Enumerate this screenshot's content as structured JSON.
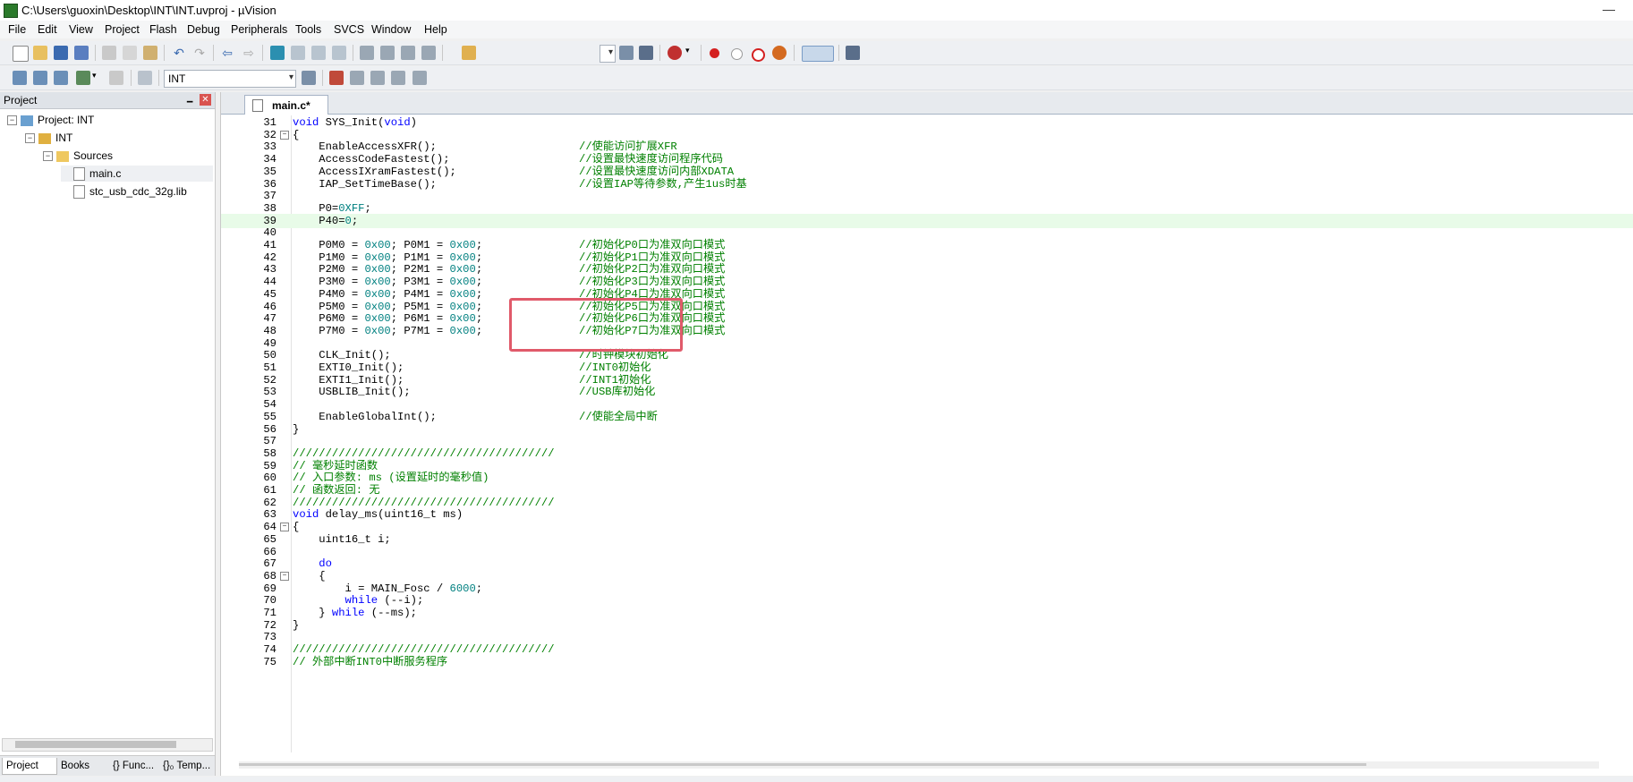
{
  "window": {
    "title": "C:\\Users\\guoxin\\Desktop\\INT\\INT.uvproj - µVision"
  },
  "menu": [
    "File",
    "Edit",
    "View",
    "Project",
    "Flash",
    "Debug",
    "Peripherals",
    "Tools",
    "SVCS",
    "Window",
    "Help"
  ],
  "toolbar2": {
    "target_value": "INT"
  },
  "project_panel": {
    "title": "Project",
    "tree": [
      {
        "label": "Project: INT",
        "level": 0,
        "icon": "project-icon"
      },
      {
        "label": "INT",
        "level": 1,
        "icon": "target-icon"
      },
      {
        "label": "Sources",
        "level": 2,
        "icon": "folder-icon"
      },
      {
        "label": "main.c",
        "level": 3,
        "icon": "file-icon"
      },
      {
        "label": "stc_usb_cdc_32g.lib",
        "level": 3,
        "icon": "file-icon"
      }
    ],
    "bottom_tabs": [
      "Project",
      "Books",
      "{} Func...",
      "{}₀ Temp..."
    ]
  },
  "editor": {
    "tab_label": "main.c*",
    "lines": [
      {
        "n": "31",
        "code": "void SYS_Init(void)",
        "comment": ""
      },
      {
        "n": "32",
        "code": "{",
        "comment": ""
      },
      {
        "n": "33",
        "code": "    EnableAccessXFR();",
        "comment": "//使能访问扩展XFR"
      },
      {
        "n": "34",
        "code": "    AccessCodeFastest();",
        "comment": "//设置最快速度访问程序代码"
      },
      {
        "n": "35",
        "code": "    AccessIXramFastest();",
        "comment": "//设置最快速度访问内部XDATA"
      },
      {
        "n": "36",
        "code": "    IAP_SetTimeBase();",
        "comment": "//设置IAP等待参数,产生1us时基"
      },
      {
        "n": "37",
        "code": "",
        "comment": ""
      },
      {
        "n": "38",
        "code": "    P0=0XFF;",
        "comment": ""
      },
      {
        "n": "39",
        "code": "    P40=0;",
        "comment": ""
      },
      {
        "n": "40",
        "code": "",
        "comment": ""
      },
      {
        "n": "41",
        "code": "    P0M0 = 0x00; P0M1 = 0x00;",
        "comment": "//初始化P0口为准双向口模式"
      },
      {
        "n": "42",
        "code": "    P1M0 = 0x00; P1M1 = 0x00;",
        "comment": "//初始化P1口为准双向口模式"
      },
      {
        "n": "43",
        "code": "    P2M0 = 0x00; P2M1 = 0x00;",
        "comment": "//初始化P2口为准双向口模式"
      },
      {
        "n": "44",
        "code": "    P3M0 = 0x00; P3M1 = 0x00;",
        "comment": "//初始化P3口为准双向口模式"
      },
      {
        "n": "45",
        "code": "    P4M0 = 0x00; P4M1 = 0x00;",
        "comment": "//初始化P4口为准双向口模式"
      },
      {
        "n": "46",
        "code": "    P5M0 = 0x00; P5M1 = 0x00;",
        "comment": "//初始化P5口为准双向口模式"
      },
      {
        "n": "47",
        "code": "    P6M0 = 0x00; P6M1 = 0x00;",
        "comment": "//初始化P6口为准双向口模式"
      },
      {
        "n": "48",
        "code": "    P7M0 = 0x00; P7M1 = 0x00;",
        "comment": "//初始化P7口为准双向口模式"
      },
      {
        "n": "49",
        "code": "",
        "comment": ""
      },
      {
        "n": "50",
        "code": "    CLK_Init();",
        "comment": "//时钟模块初始化"
      },
      {
        "n": "51",
        "code": "    EXTI0_Init();",
        "comment": "//INT0初始化"
      },
      {
        "n": "52",
        "code": "    EXTI1_Init();",
        "comment": "//INT1初始化"
      },
      {
        "n": "53",
        "code": "    USBLIB_Init();",
        "comment": "//USB库初始化"
      },
      {
        "n": "54",
        "code": "",
        "comment": ""
      },
      {
        "n": "55",
        "code": "    EnableGlobalInt();",
        "comment": "//使能全局中断"
      },
      {
        "n": "56",
        "code": "}",
        "comment": ""
      },
      {
        "n": "57",
        "code": "",
        "comment": ""
      },
      {
        "n": "58",
        "code": "",
        "comment": "////////////////////////////////////////"
      },
      {
        "n": "59",
        "code": "",
        "comment": "// 毫秒延时函数"
      },
      {
        "n": "60",
        "code": "",
        "comment": "// 入口参数: ms (设置延时的毫秒值)"
      },
      {
        "n": "61",
        "code": "",
        "comment": "// 函数返回: 无"
      },
      {
        "n": "62",
        "code": "",
        "comment": "////////////////////////////////////////"
      },
      {
        "n": "63",
        "code": "void delay_ms(uint16_t ms)",
        "comment": ""
      },
      {
        "n": "64",
        "code": "{",
        "comment": ""
      },
      {
        "n": "65",
        "code": "    uint16_t i;",
        "comment": ""
      },
      {
        "n": "66",
        "code": "",
        "comment": ""
      },
      {
        "n": "67",
        "code": "    do",
        "comment": ""
      },
      {
        "n": "68",
        "code": "    {",
        "comment": ""
      },
      {
        "n": "69",
        "code": "        i = MAIN_Fosc / 6000;",
        "comment": ""
      },
      {
        "n": "70",
        "code": "        while (--i);",
        "comment": ""
      },
      {
        "n": "71",
        "code": "    } while (--ms);",
        "comment": ""
      },
      {
        "n": "72",
        "code": "}",
        "comment": ""
      },
      {
        "n": "73",
        "code": "",
        "comment": ""
      },
      {
        "n": "74",
        "code": "",
        "comment": "////////////////////////////////////////"
      },
      {
        "n": "75",
        "code": "",
        "comment": "// 外部中断INT0中断服务程序"
      }
    ]
  },
  "colors": {
    "keyword": "#0000ff",
    "number": "#008080",
    "comment": "#008000",
    "highlight_box": "#e05a6a",
    "current_line": "#e8fbe8"
  }
}
